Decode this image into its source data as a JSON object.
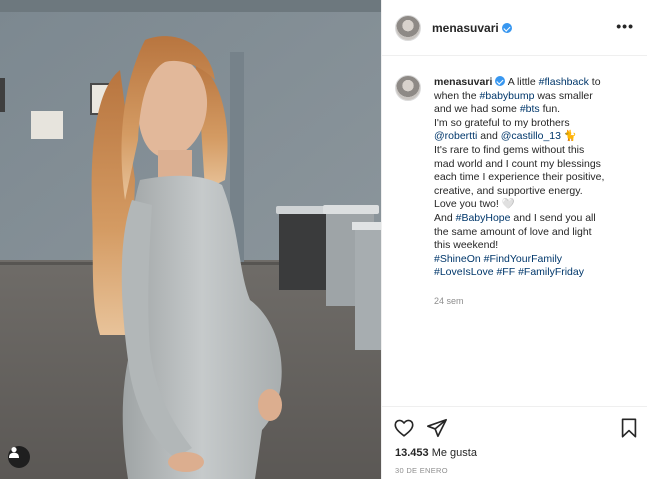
{
  "post": {
    "username": "menasuvari",
    "caption_lines": [
      {
        "parts": [
          {
            "t": "menasuvari",
            "k": "user"
          },
          {
            "t": " ",
            "k": "verified"
          },
          {
            "t": " A little ",
            "k": "text"
          },
          {
            "t": "#flashback",
            "k": "tag"
          },
          {
            "t": " to",
            "k": "text"
          }
        ]
      },
      {
        "parts": [
          {
            "t": "when the ",
            "k": "text"
          },
          {
            "t": "#babybump",
            "k": "tag"
          },
          {
            "t": " was smaller",
            "k": "text"
          }
        ]
      },
      {
        "parts": [
          {
            "t": "and we had some ",
            "k": "text"
          },
          {
            "t": "#bts",
            "k": "tag"
          },
          {
            "t": " fun.",
            "k": "text"
          }
        ]
      },
      {
        "parts": [
          {
            "t": "I'm so grateful to my brothers",
            "k": "text"
          }
        ]
      },
      {
        "parts": [
          {
            "t": "@robertti",
            "k": "tag"
          },
          {
            "t": " and ",
            "k": "text"
          },
          {
            "t": "@castillo_13",
            "k": "tag"
          },
          {
            "t": " 🐈",
            "k": "text"
          }
        ]
      },
      {
        "parts": [
          {
            "t": "It's rare to find gems without this",
            "k": "text"
          }
        ]
      },
      {
        "parts": [
          {
            "t": "mad world and I count my blessings",
            "k": "text"
          }
        ]
      },
      {
        "parts": [
          {
            "t": "each time I experience their positive,",
            "k": "text"
          }
        ]
      },
      {
        "parts": [
          {
            "t": "creative, and supportive energy.",
            "k": "text"
          }
        ]
      },
      {
        "parts": [
          {
            "t": "Love you two! 🤍",
            "k": "text"
          }
        ]
      },
      {
        "parts": [
          {
            "t": "And ",
            "k": "text"
          },
          {
            "t": "#BabyHope",
            "k": "tag"
          },
          {
            "t": " and I send you all",
            "k": "text"
          }
        ]
      },
      {
        "parts": [
          {
            "t": "the same amount of love and light",
            "k": "text"
          }
        ]
      },
      {
        "parts": [
          {
            "t": "this weekend!",
            "k": "text"
          }
        ]
      },
      {
        "parts": [
          {
            "t": "#ShineOn",
            "k": "tag"
          },
          {
            "t": " ",
            "k": "text"
          },
          {
            "t": "#FindYourFamily",
            "k": "tag"
          }
        ]
      },
      {
        "parts": [
          {
            "t": "#LoveIsLove",
            "k": "tag"
          },
          {
            "t": " ",
            "k": "text"
          },
          {
            "t": "#FF",
            "k": "tag"
          },
          {
            "t": " ",
            "k": "text"
          },
          {
            "t": "#FamilyFriday",
            "k": "tag"
          }
        ]
      }
    ],
    "time_ago": "24 sem",
    "likes_count": "13.453",
    "likes_label": "Me gusta",
    "date": "30 DE ENERO"
  },
  "icons": {
    "more": "more-options-icon",
    "like": "heart-icon",
    "share": "paper-plane-icon",
    "save": "bookmark-icon",
    "tag_people": "user-tag-icon"
  },
  "colors": {
    "hashtag": "#00376b",
    "verified": "#3897f0",
    "muted": "#8e8e8e",
    "text": "#262626"
  }
}
